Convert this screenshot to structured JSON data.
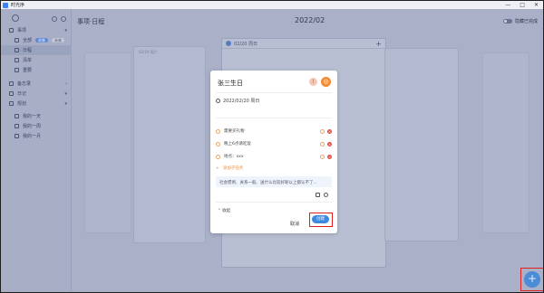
{
  "app": {
    "title": "时光序"
  },
  "window": {
    "controls": [
      "—",
      "□",
      "✕"
    ]
  },
  "sidebar": {
    "items": [
      {
        "label": "事项",
        "group": true
      },
      {
        "label": "全部",
        "chips": [
          "收集",
          "未来"
        ]
      },
      {
        "label": "日程",
        "active": true
      },
      {
        "label": "清单"
      },
      {
        "label": "重要"
      },
      {
        "label": "备忘录",
        "group": true
      },
      {
        "label": "日记",
        "group": true
      },
      {
        "label": "规划",
        "group": true
      },
      {
        "label": "我的一天"
      },
      {
        "label": "我的一周"
      },
      {
        "label": "我的一月"
      }
    ]
  },
  "main": {
    "page_title": "事项·日程",
    "month": "2022/02",
    "hide_completed": "隐藏已完成",
    "cards": [
      {
        "header": "02/19 周六"
      },
      {
        "header": "02/20 周日"
      },
      {
        "header": ""
      }
    ]
  },
  "dialog": {
    "title": "张三生日",
    "date": "2022/02/20 周日",
    "subtasks": [
      {
        "label": "需要买礼物"
      },
      {
        "label": "晚上6点请吃饭"
      },
      {
        "label": "地点：xxx"
      }
    ],
    "add_subtask": "添加子任务",
    "note": "社会惯例、关系一般、送什么比较好呢以上都认不了...",
    "collapse": "收起",
    "cancel": "取消",
    "create": "创建"
  },
  "fab": {
    "label": "+"
  },
  "colors": {
    "accent": "#3b89e0",
    "orange": "#f58a2e",
    "danger": "#e5483e"
  }
}
